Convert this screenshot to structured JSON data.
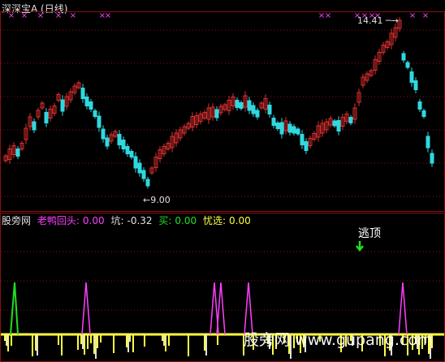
{
  "top": {
    "title": "深深宝A (日线)",
    "high_label": "14.41",
    "low_label": "9.00",
    "marker_glyph": "×",
    "colors": {
      "up": "#e03030",
      "down": "#30d8e0",
      "grid": "#8b1010",
      "marker": "#ff40ff"
    }
  },
  "bottom": {
    "legend": {
      "source": "股旁网",
      "duck_label": "老鸭回头:",
      "duck_value": "0.00",
      "pit_label": "坑:",
      "pit_value": "-0.32",
      "buy_label": "买:",
      "buy_value": "0.00",
      "pick_label": "忧选:",
      "pick_value": "0.00"
    },
    "escape_label": "逃顶",
    "colors": {
      "duck": "#ff40ff",
      "pit": "#e0e0e0",
      "buy": "#20e020",
      "pick": "#ffff40",
      "baseline": "#ffff40"
    }
  },
  "watermark": "股旁网 www.gupang.com"
}
